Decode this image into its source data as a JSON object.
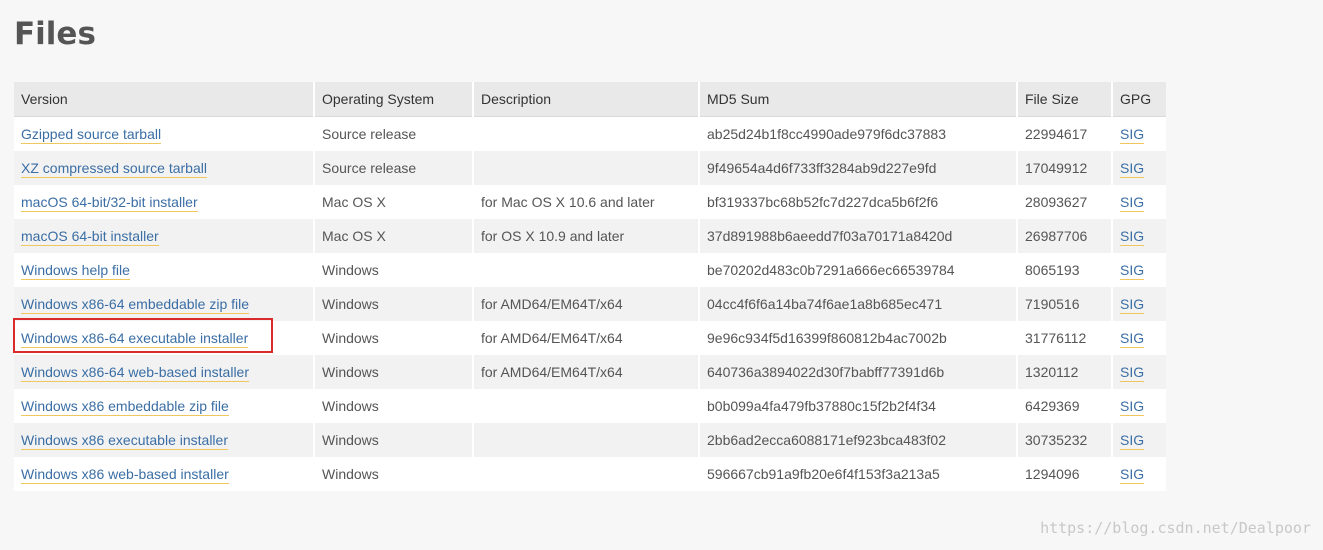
{
  "page": {
    "title": "Files",
    "watermark": "https://blog.csdn.net/Dealpoor"
  },
  "table": {
    "headers": [
      "Version",
      "Operating System",
      "Description",
      "MD5 Sum",
      "File Size",
      "GPG"
    ],
    "rows": [
      {
        "version": "Gzipped source tarball",
        "os": "Source release",
        "description": "",
        "md5": "ab25d24b1f8cc4990ade979f6dc37883",
        "size": "22994617",
        "gpg": "SIG"
      },
      {
        "version": "XZ compressed source tarball",
        "os": "Source release",
        "description": "",
        "md5": "9f49654a4d6f733ff3284ab9d227e9fd",
        "size": "17049912",
        "gpg": "SIG"
      },
      {
        "version": "macOS 64-bit/32-bit installer",
        "os": "Mac OS X",
        "description": "for Mac OS X 10.6 and later",
        "md5": "bf319337bc68b52fc7d227dca5b6f2f6",
        "size": "28093627",
        "gpg": "SIG"
      },
      {
        "version": "macOS 64-bit installer",
        "os": "Mac OS X",
        "description": "for OS X 10.9 and later",
        "md5": "37d891988b6aeedd7f03a70171a8420d",
        "size": "26987706",
        "gpg": "SIG"
      },
      {
        "version": "Windows help file",
        "os": "Windows",
        "description": "",
        "md5": "be70202d483c0b7291a666ec66539784",
        "size": "8065193",
        "gpg": "SIG"
      },
      {
        "version": "Windows x86-64 embeddable zip file",
        "os": "Windows",
        "description": "for AMD64/EM64T/x64",
        "md5": "04cc4f6f6a14ba74f6ae1a8b685ec471",
        "size": "7190516",
        "gpg": "SIG"
      },
      {
        "version": "Windows x86-64 executable installer",
        "os": "Windows",
        "description": "for AMD64/EM64T/x64",
        "md5": "9e96c934f5d16399f860812b4ac7002b",
        "size": "31776112",
        "gpg": "SIG"
      },
      {
        "version": "Windows x86-64 web-based installer",
        "os": "Windows",
        "description": "for AMD64/EM64T/x64",
        "md5": "640736a3894022d30f7babff77391d6b",
        "size": "1320112",
        "gpg": "SIG"
      },
      {
        "version": "Windows x86 embeddable zip file",
        "os": "Windows",
        "description": "",
        "md5": "b0b099a4fa479fb37880c15f2b2f4f34",
        "size": "6429369",
        "gpg": "SIG"
      },
      {
        "version": "Windows x86 executable installer",
        "os": "Windows",
        "description": "",
        "md5": "2bb6ad2ecca6088171ef923bca483f02",
        "size": "30735232",
        "gpg": "SIG"
      },
      {
        "version": "Windows x86 web-based installer",
        "os": "Windows",
        "description": "",
        "md5": "596667cb91a9fb20e6f4f153f3a213a5",
        "size": "1294096",
        "gpg": "SIG"
      }
    ]
  },
  "colors": {
    "link": "#3a6ea5",
    "link_underline": "#f0c75e",
    "highlight_border": "#d92b2b",
    "header_bg": "#e9e9e9",
    "page_bg": "#f7f7f7"
  }
}
